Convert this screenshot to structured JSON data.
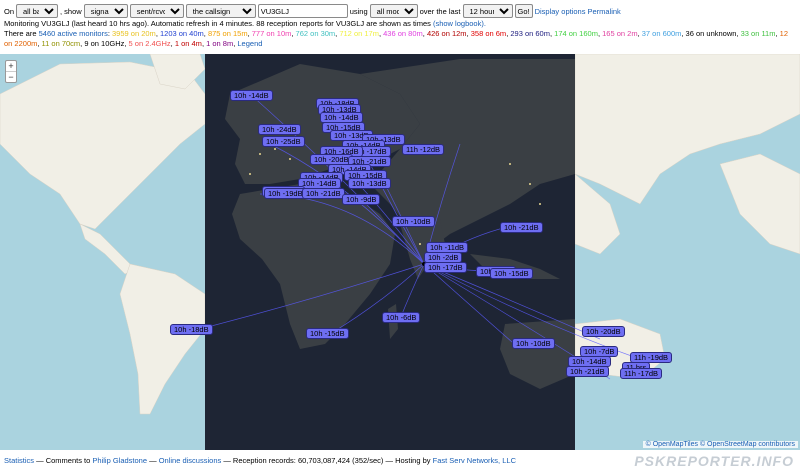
{
  "controls": {
    "prefix": "On",
    "band": "all bands",
    "show_label": ", show",
    "show": "signals",
    "direction": "sent/rcvd by",
    "target": "the callsign",
    "callsign": "VU3GLJ",
    "using_label": "using",
    "mode": "all modes",
    "over_label": "over the last",
    "period": "12 hours",
    "go_label": "Go!",
    "display_options": "Display options",
    "permalink": "Permalink"
  },
  "status": {
    "text": "Monitoring VU3GLJ (last heard 10 hrs ago). Automatic refresh in 4 minutes. 88 reception reports for VU3GLJ are shown as times",
    "logbook_link": "(show logbook)."
  },
  "monitors": {
    "prefix": "There are",
    "active": "5460 active monitors",
    "bands": [
      {
        "text": "3959 on 20m",
        "color": "#e8c220"
      },
      {
        "text": "1203 on 40m",
        "color": "#1f3fd0"
      },
      {
        "text": "875 on 15m",
        "color": "#f0a000"
      },
      {
        "text": "777 on 10m",
        "color": "#f040b0"
      },
      {
        "text": "762 on 30m",
        "color": "#40c0c0"
      },
      {
        "text": "712 on 17m",
        "color": "#f0f040"
      },
      {
        "text": "436 on 80m",
        "color": "#e040e0"
      },
      {
        "text": "426 on 12m",
        "color": "#b00000"
      },
      {
        "text": "358 on 6m",
        "color": "#e00000"
      },
      {
        "text": "293 on 60m",
        "color": "#202080"
      },
      {
        "text": "174 on 160m",
        "color": "#40d040"
      },
      {
        "text": "165 on 2m",
        "color": "#e040a0"
      },
      {
        "text": "37 on 600m",
        "color": "#40a0e0"
      },
      {
        "text": "36 on unknown",
        "color": "#000000"
      },
      {
        "text": "33 on 11m",
        "color": "#40c040"
      },
      {
        "text": "12 on 2200m",
        "color": "#e06000"
      },
      {
        "text": "11 on 70cm",
        "color": "#909000"
      },
      {
        "text": "9 on 10GHz",
        "color": "#000000"
      },
      {
        "text": "5 on 2.4GHz",
        "color": "#f05050"
      },
      {
        "text": "1 on 4m",
        "color": "#c00000"
      },
      {
        "text": "1 on 8m",
        "color": "#800080"
      }
    ],
    "legend_link": "Legend"
  },
  "map": {
    "zoom_in": "+",
    "zoom_out": "−",
    "attribution_a": "© OpenMapTiles",
    "attribution_b": "© OpenStreetMap contributors",
    "colors": {
      "ocean": "#aad3df",
      "land": "#f1efe6",
      "night": "#1e2534",
      "night_land": "#3a3f44",
      "path": "#5a5aff",
      "spot": "#6e6ef2"
    },
    "spots": [
      {
        "label": "10h -14dB"
      },
      {
        "label": "10h -18dB"
      },
      {
        "label": "10h -13dB"
      },
      {
        "label": "10h -14dB"
      },
      {
        "label": "10h -24dB"
      },
      {
        "label": "10h -15dB"
      },
      {
        "label": "10h -13dB"
      },
      {
        "label": "10h -25dB"
      },
      {
        "label": "10h -13dB"
      },
      {
        "label": "10h -14dB"
      },
      {
        "label": "11h -12dB"
      },
      {
        "label": "10h -17dB"
      },
      {
        "label": "10h -16dB"
      },
      {
        "label": "10h -20dB"
      },
      {
        "label": "10h -21dB"
      },
      {
        "label": "10h -14dB"
      },
      {
        "label": "10h -14dB"
      },
      {
        "label": "10h -15dB"
      },
      {
        "label": "10h -14dB"
      },
      {
        "label": "10h -13dB"
      },
      {
        "label": "10h -18dB"
      },
      {
        "label": "10h -19dB"
      },
      {
        "label": "10h -21dB"
      },
      {
        "label": "10h -9dB"
      },
      {
        "label": "10h -10dB"
      },
      {
        "label": "10h -21dB"
      },
      {
        "label": "10h -11dB"
      },
      {
        "label": "10h -2dB"
      },
      {
        "label": "10h -17dB"
      },
      {
        "label": "10h +2dB"
      },
      {
        "label": "10h -15dB"
      },
      {
        "label": "10h -6dB"
      },
      {
        "label": "10h -18dB"
      },
      {
        "label": "10h -15dB"
      },
      {
        "label": "10h -20dB"
      },
      {
        "label": "10h -10dB"
      },
      {
        "label": "10h -7dB"
      },
      {
        "label": "10h -14dB"
      },
      {
        "label": "11h -19dB"
      },
      {
        "label": "11 hrs"
      },
      {
        "label": "10h -21dB"
      },
      {
        "label": "11h -17dB"
      }
    ]
  },
  "footer": {
    "statistics": "Statistics",
    "comments": "— Comments to",
    "author": "Philip Gladstone",
    "sep1": "—",
    "discussions": "Online discussions",
    "records": "— Reception records: 60,703,087,424 (352/sec) — Hosting by",
    "host": "Fast Serv Networks, LLC",
    "brand": "PSKREPORTER.INFO"
  }
}
